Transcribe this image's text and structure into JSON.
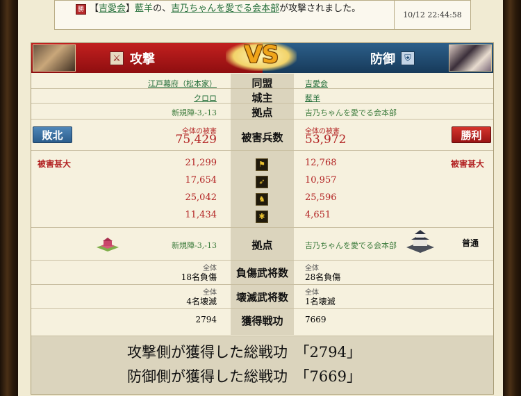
{
  "notice": {
    "prefix": "【",
    "alliance": "吉愛会",
    "mid1": "】",
    "player": "藍羊",
    "mid2": "の、",
    "target": "吉乃ちゃんを愛でる会本部",
    "suffix": "が攻撃されました。",
    "time": "10/12 22:44:58",
    "icon_label": "勝"
  },
  "header": {
    "attack_label": "攻撃",
    "defense_label": "防御",
    "vs": "VS"
  },
  "info": {
    "alliance_label": "同盟",
    "lord_label": "城主",
    "base_label": "拠点",
    "attacker_alliance": "江戸幕府（松本家）",
    "attacker_lord": "クロロ",
    "attacker_base": "新規陣-3,-13",
    "defender_alliance": "吉愛会",
    "defender_lord": "藍羊",
    "defender_base": "吉乃ちゃんを愛でる会本部"
  },
  "damage": {
    "label": "被害兵数",
    "total_caption": "全体の被害",
    "attacker_total": "75,429",
    "defender_total": "53,972",
    "attacker_result": "敗北",
    "defender_result": "勝利",
    "attacker_grade": "被害甚大",
    "defender_grade": "被害甚大",
    "units": [
      {
        "icon": "spear-icon",
        "glyph": "⚑",
        "attacker": "21,299",
        "defender": "12,768"
      },
      {
        "icon": "bow-icon",
        "glyph": "➶",
        "attacker": "17,654",
        "defender": "10,957"
      },
      {
        "icon": "horse-icon",
        "glyph": "♞",
        "attacker": "25,042",
        "defender": "25,596"
      },
      {
        "icon": "siege-icon",
        "glyph": "✱",
        "attacker": "11,434",
        "defender": "4,651"
      }
    ]
  },
  "base_row": {
    "label": "拠点",
    "attacker_base": "新規陣-3,-13",
    "defender_base": "吉乃ちゃんを愛でる会本部",
    "defender_status": "普通"
  },
  "injured": {
    "label": "負傷武将数",
    "caption": "全体",
    "attacker": "18名負傷",
    "defender": "28名負傷"
  },
  "destroyed": {
    "label": "壊滅武将数",
    "caption": "全体",
    "attacker": "4名壊滅",
    "defender": "1名壊滅"
  },
  "merit": {
    "label": "獲得戦功",
    "attacker": "2794",
    "defender": "7669"
  },
  "summary": {
    "attacker_text": "攻撃側が獲得した総戦功　「2794」",
    "defender_text": "防御側が獲得した総戦功　「7669」"
  }
}
